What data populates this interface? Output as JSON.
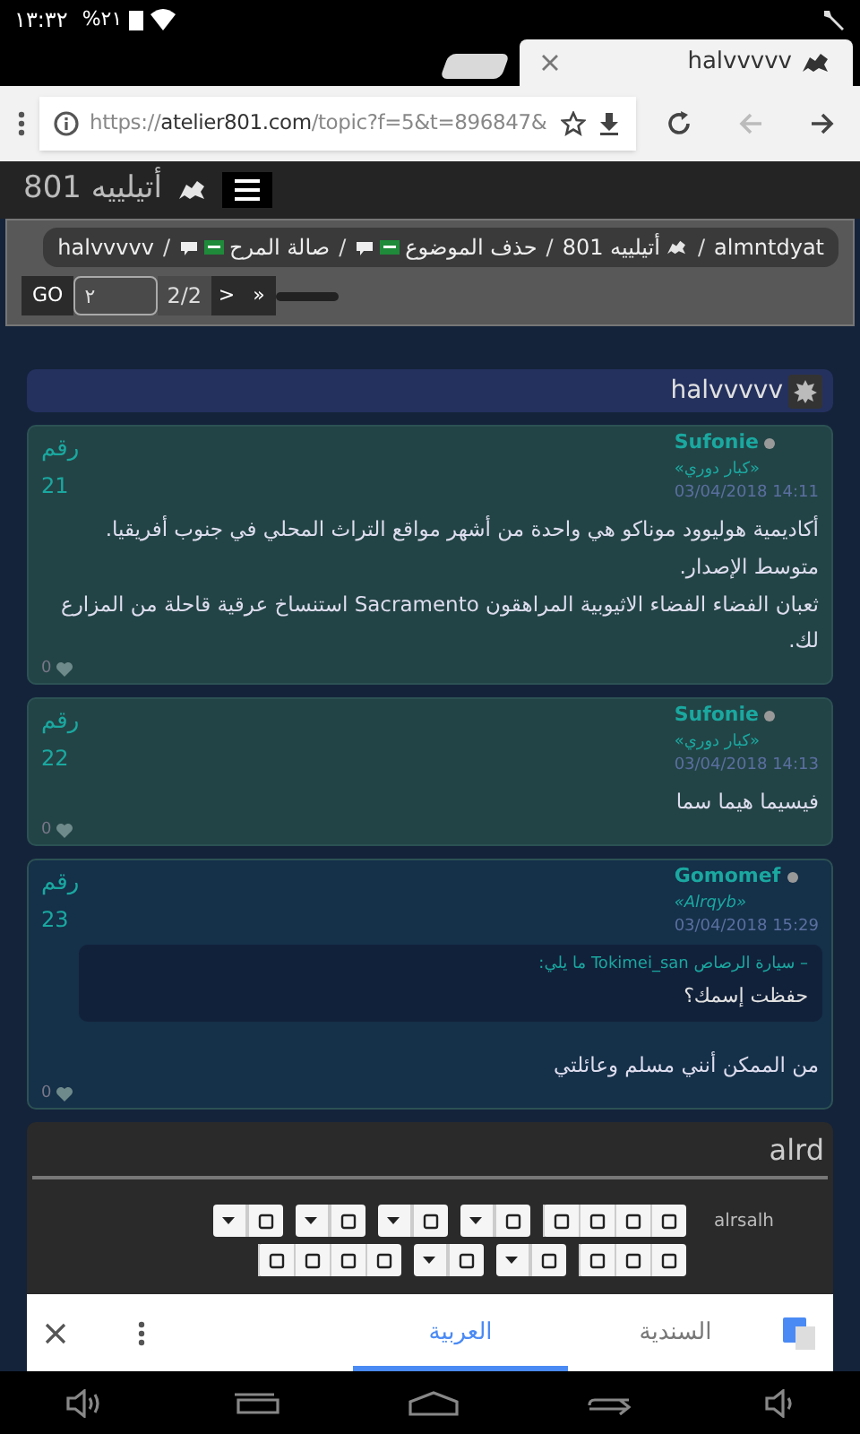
{
  "status_bar": {
    "time": "١٣:٣٢",
    "battery": "%٢١"
  },
  "browser": {
    "tab": {
      "title": "halvvvvv",
      "selected": true
    },
    "url": {
      "scheme": "https://",
      "host": "atelier801.com",
      "path": "/topic?f=5&t=896847&"
    }
  },
  "site": {
    "title": "أتيلييه 801"
  },
  "breadcrumb": {
    "separator": "/",
    "items": [
      {
        "label": "almntdyat",
        "kind": "plain"
      },
      {
        "label": "أتيلييه 801",
        "kind": "forum"
      },
      {
        "label": "حذف الموضوع",
        "kind": "category"
      },
      {
        "label": "صالة المرح",
        "kind": "category"
      },
      {
        "label": "halvvvvv",
        "kind": "plain"
      }
    ]
  },
  "pagination": {
    "go": "GO",
    "page_value": "٢",
    "pages": "2/2",
    "next": ">",
    "last": "»"
  },
  "topic": {
    "title": "halvvvvv"
  },
  "posts": [
    {
      "author": "Sufonie",
      "rank": "«كبار دوري»",
      "rank_italic": false,
      "date": "14:11 03/04/2018",
      "number_label": "رقم",
      "number": "21",
      "highlighted": false,
      "paragraphs": [
        "أكاديمية هوليوود موناكو هي واحدة من أشهر مواقع التراث المحلي في جنوب أفريقيا.",
        "متوسط الإصدار.",
        "ثعبان الفضاء الفضاء الاثيوبية المراهقون Sacramento استنساخ عرقية قاحلة من المزارع لك."
      ],
      "likes": "0"
    },
    {
      "author": "Sufonie",
      "rank": "«كبار دوري»",
      "rank_italic": false,
      "date": "14:13 03/04/2018",
      "number_label": "رقم",
      "number": "22",
      "highlighted": false,
      "paragraphs": [
        "فيسيما هيما سما"
      ],
      "likes": "0"
    },
    {
      "author": "Gomomef",
      "rank": "«Alrqyb»",
      "rank_italic": true,
      "date": "15:29 03/04/2018",
      "number_label": "رقم",
      "number": "23",
      "highlighted": true,
      "quote": {
        "header": "– سيارة الرصاص Tokimei_san ما يلي:",
        "text": "حفظت إسمك؟"
      },
      "paragraphs": [
        "من الممكن أنني مسلم وعائلتي"
      ],
      "likes": "0"
    }
  ],
  "editor": {
    "title": "alrd",
    "label": "alrsalh"
  },
  "translate_bar": {
    "tabs": [
      {
        "label": "السندية",
        "selected": false
      },
      {
        "label": "العربية",
        "selected": true
      }
    ]
  }
}
